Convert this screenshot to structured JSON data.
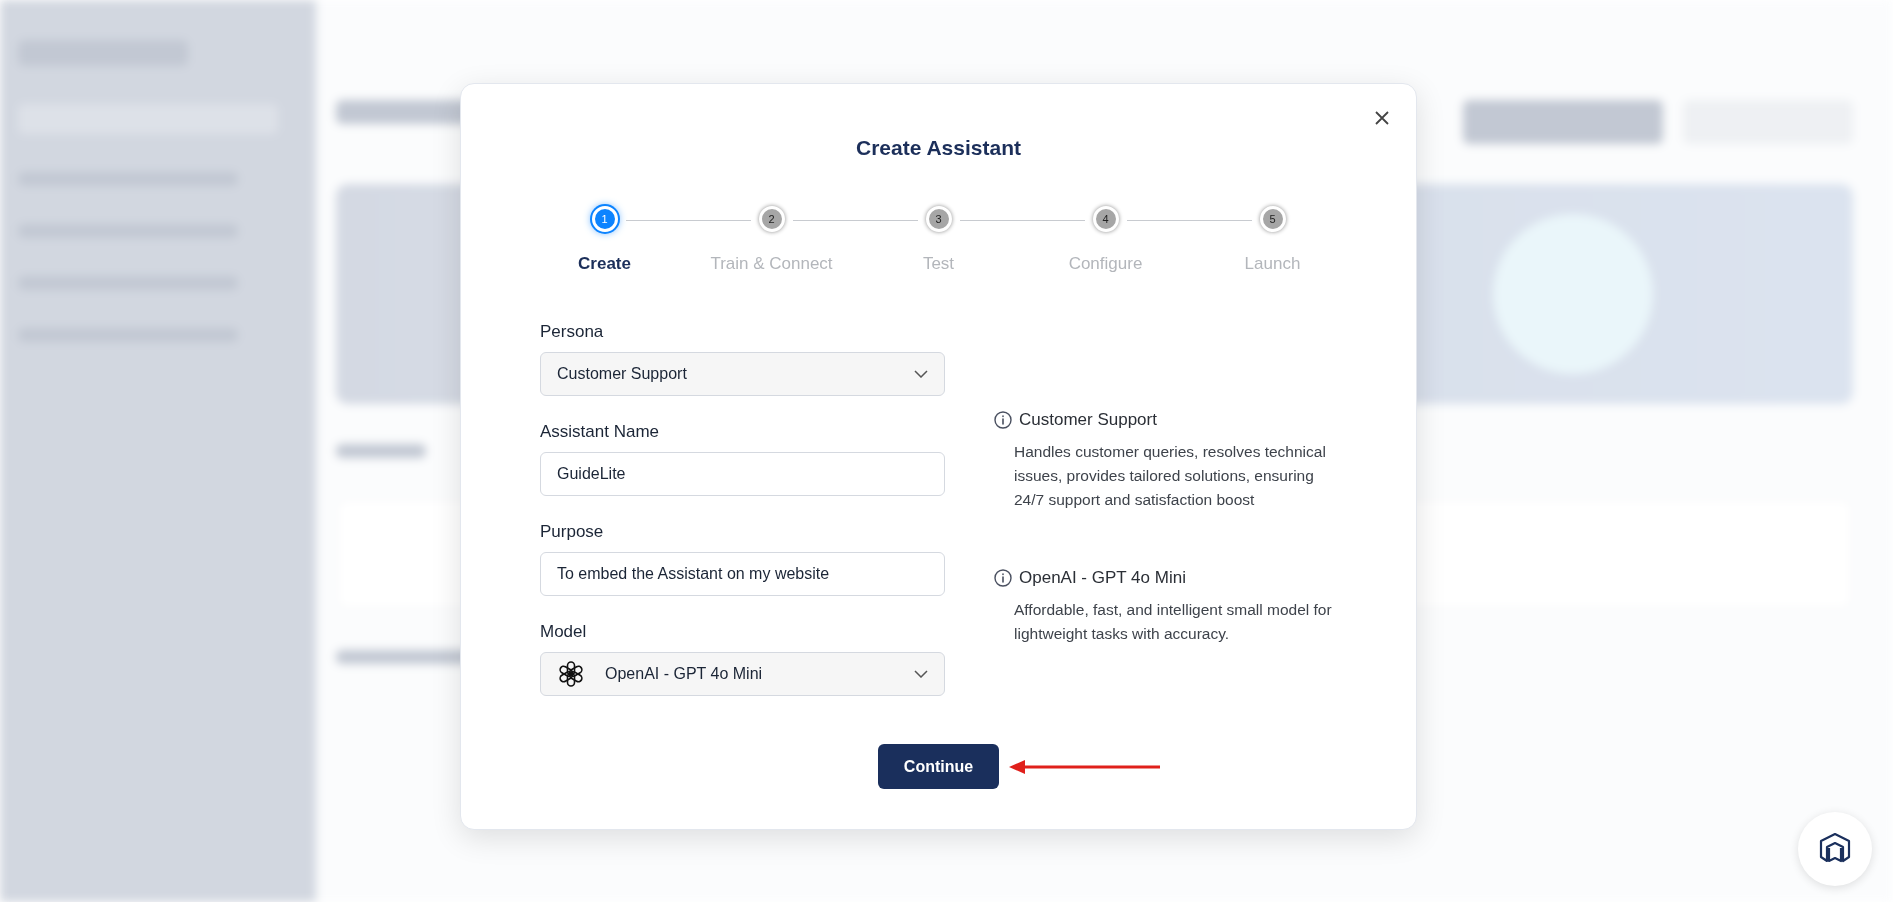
{
  "dialog": {
    "title": "Create Assistant",
    "steps": [
      {
        "number": "1",
        "label": "Create",
        "selected": true
      },
      {
        "number": "2",
        "label": "Train & Connect",
        "selected": false
      },
      {
        "number": "3",
        "label": "Test",
        "selected": false
      },
      {
        "number": "4",
        "label": "Configure",
        "selected": false
      },
      {
        "number": "5",
        "label": "Launch",
        "selected": false
      }
    ],
    "fields": [
      {
        "kind": "select",
        "label": "Persona",
        "value": "Customer Support",
        "logo": false
      },
      {
        "kind": "input",
        "label": "Assistant Name",
        "value": "GuideLite"
      },
      {
        "kind": "input",
        "label": "Purpose",
        "value": "To embed the Assistant on my website"
      },
      {
        "kind": "select",
        "label": "Model",
        "value": "OpenAI - GPT 4o Mini",
        "logo": true
      }
    ],
    "info": [
      {
        "title": "Customer Support",
        "text": "Handles customer queries, resolves technical issues, provides tailored solutions, ensuring 24/7 support and satisfaction boost"
      },
      {
        "title": "OpenAI - GPT 4o Mini",
        "text": "Affordable, fast, and intelligent small model for lightweight tasks with accuracy."
      }
    ],
    "continue_button": "Continue"
  }
}
